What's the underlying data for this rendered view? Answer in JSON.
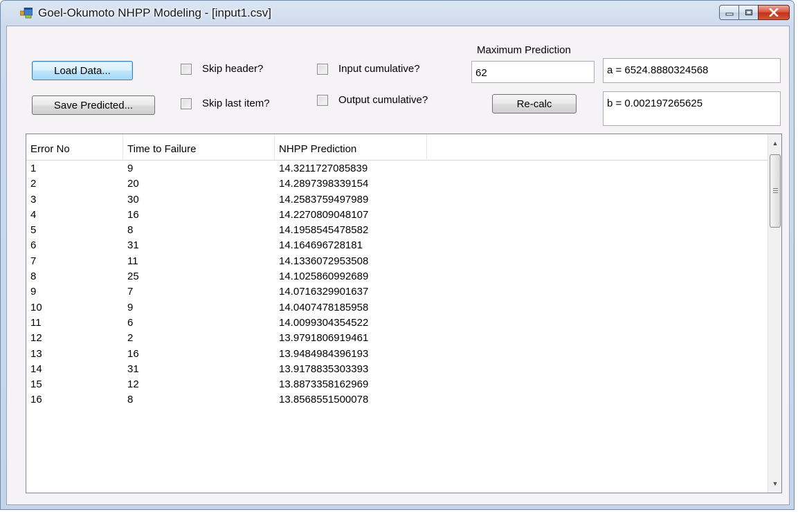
{
  "window": {
    "title": "Goel-Okumoto NHPP Modeling - [input1.csv]"
  },
  "toolbar": {
    "load_label": "Load Data...",
    "save_label": "Save Predicted...",
    "recalc_label": "Re-calc"
  },
  "options": {
    "skip_header": {
      "label": "Skip header?",
      "checked": false
    },
    "skip_last": {
      "label": "Skip last item?",
      "checked": false
    },
    "input_cumulative": {
      "label": "Input cumulative?",
      "checked": false
    },
    "output_cumulative": {
      "label": "Output cumulative?",
      "checked": false
    }
  },
  "prediction": {
    "label": "Maximum Prediction",
    "value": "62"
  },
  "params": {
    "a": "a = 6524.8880324568",
    "b": "b = 0.002197265625"
  },
  "table": {
    "columns": [
      "Error No",
      "Time to Failure",
      "NHPP Prediction"
    ],
    "rows": [
      [
        "1",
        "9",
        "14.3211727085839"
      ],
      [
        "2",
        "20",
        "14.2897398339154"
      ],
      [
        "3",
        "30",
        "14.2583759497989"
      ],
      [
        "4",
        "16",
        "14.2270809048107"
      ],
      [
        "5",
        "8",
        "14.1958545478582"
      ],
      [
        "6",
        "31",
        "14.164696728181"
      ],
      [
        "7",
        "11",
        "14.1336072953508"
      ],
      [
        "8",
        "25",
        "14.1025860992689"
      ],
      [
        "9",
        "7",
        "14.0716329901637"
      ],
      [
        "10",
        "9",
        "14.0407478185958"
      ],
      [
        "11",
        "6",
        "14.0099304354522"
      ],
      [
        "12",
        "2",
        "13.9791806919461"
      ],
      [
        "13",
        "16",
        "13.9484984396193"
      ],
      [
        "14",
        "31",
        "13.9178835303393"
      ],
      [
        "15",
        "12",
        "13.8873358162969"
      ],
      [
        "16",
        "8",
        "13.8568551500078"
      ]
    ]
  }
}
